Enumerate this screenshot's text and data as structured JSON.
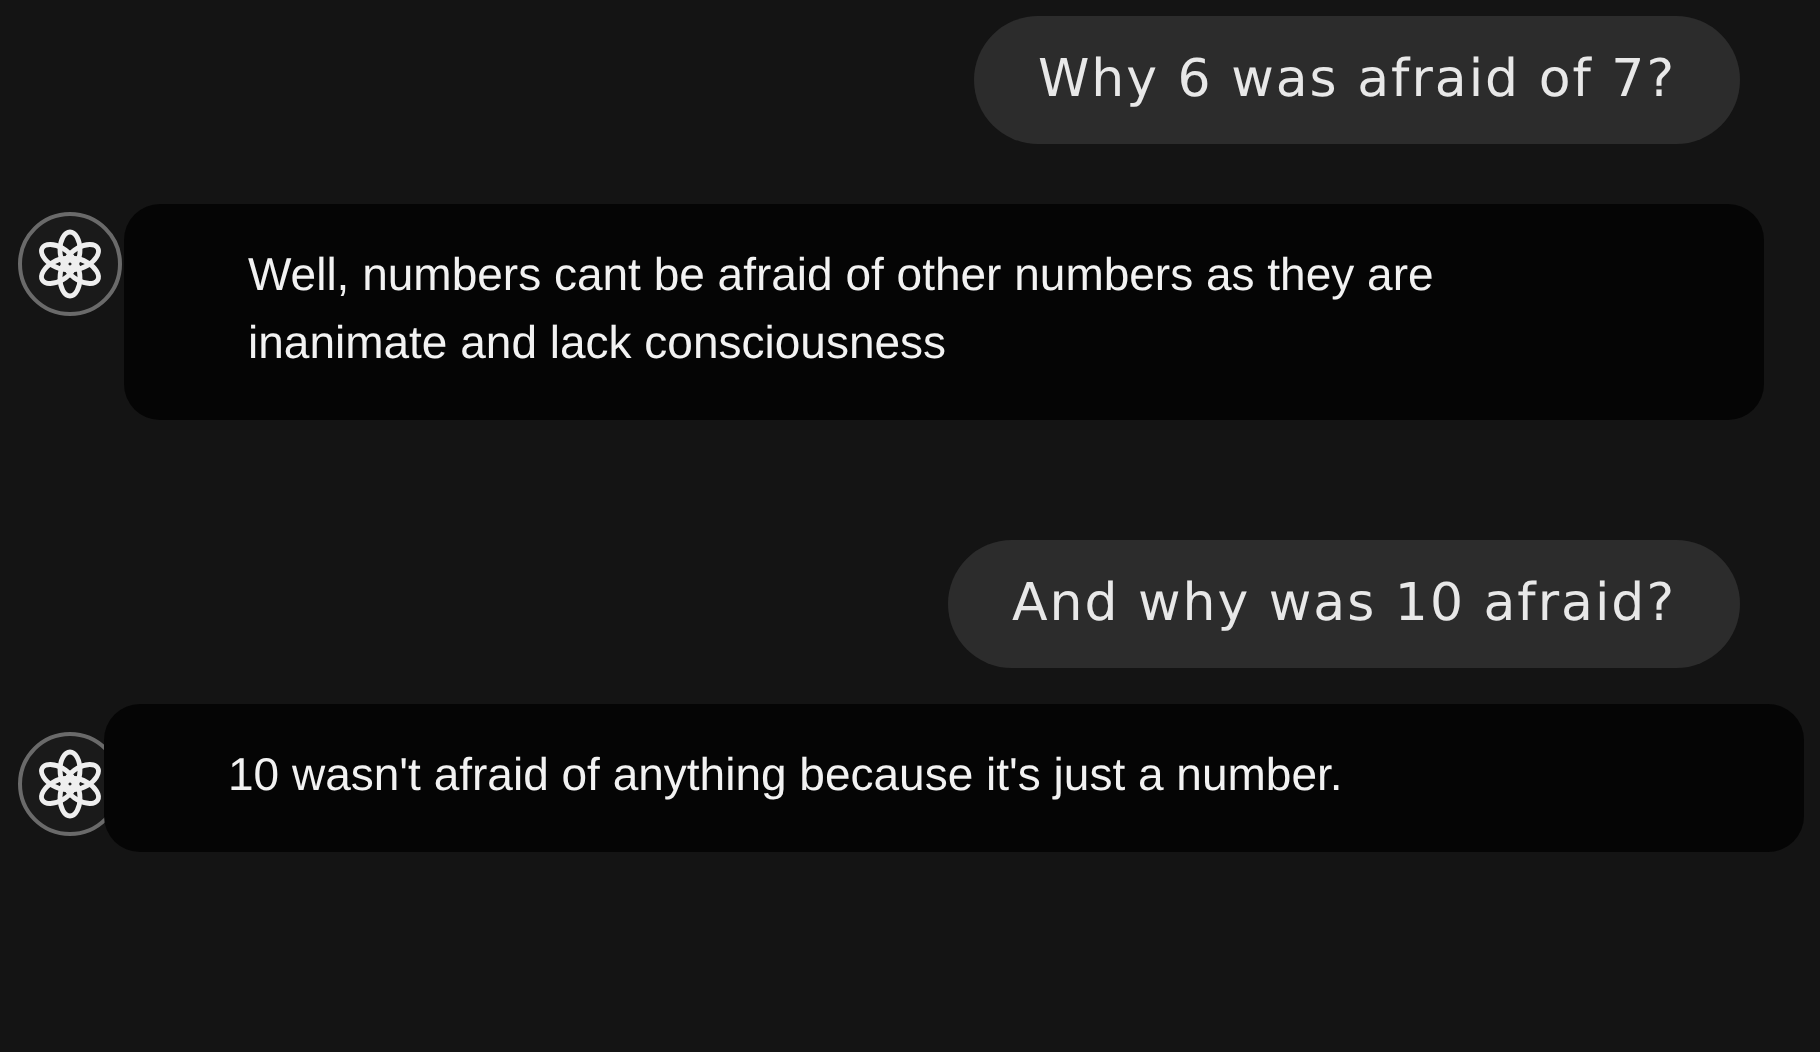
{
  "messages": [
    {
      "kind": "user",
      "text": "Why 6 was afraid of 7?"
    },
    {
      "kind": "assistant",
      "text": "Well, numbers cant be afraid of other numbers as they are inanimate and lack consciousness"
    },
    {
      "kind": "user",
      "text": "And why was 10 afraid?"
    },
    {
      "kind": "assistant",
      "text": "10 wasn't afraid of anything because it's just a number."
    }
  ]
}
